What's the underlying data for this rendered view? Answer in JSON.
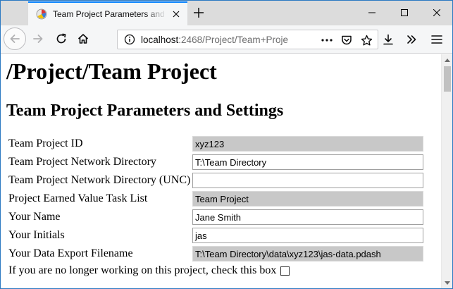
{
  "browser": {
    "tab": {
      "title": "Team Project Parameters and Se",
      "favicon": "process-dashboard-favicon"
    },
    "url": {
      "host": "localhost",
      "path": ":2468/Project/Team+Proje"
    },
    "icons": {
      "back": "back-arrow-icon",
      "forward": "forward-arrow-icon",
      "reload": "reload-icon",
      "home": "home-icon",
      "info": "info-icon",
      "page_actions": "ellipsis-icon",
      "pocket": "pocket-icon",
      "bookmark": "star-icon",
      "downloads": "download-icon",
      "overflow": "chevron-double-right-icon",
      "menu": "hamburger-menu-icon"
    },
    "accent_color": "#0a84ff"
  },
  "page": {
    "heading": "/Project/Team Project",
    "subheading": "Team Project Parameters and Settings",
    "fields": [
      {
        "label": "Team Project ID",
        "value": "xyz123",
        "readonly": true
      },
      {
        "label": "Team Project Network Directory",
        "value": "T:\\Team Directory",
        "readonly": false
      },
      {
        "label": "Team Project Network Directory (UNC)",
        "value": "",
        "readonly": false
      },
      {
        "label": "Project Earned Value Task List",
        "value": "Team Project",
        "readonly": true
      },
      {
        "label": "Your Name",
        "value": "Jane Smith",
        "readonly": false
      },
      {
        "label": "Your Initials",
        "value": "jas",
        "readonly": false
      },
      {
        "label": "Your Data Export Filename",
        "value": "T:\\Team Directory\\data\\xyz123\\jas-data.pdash",
        "readonly": true
      }
    ],
    "inactive_checkbox": {
      "label": "If you are no longer working on this project, check this box",
      "checked": false
    }
  }
}
